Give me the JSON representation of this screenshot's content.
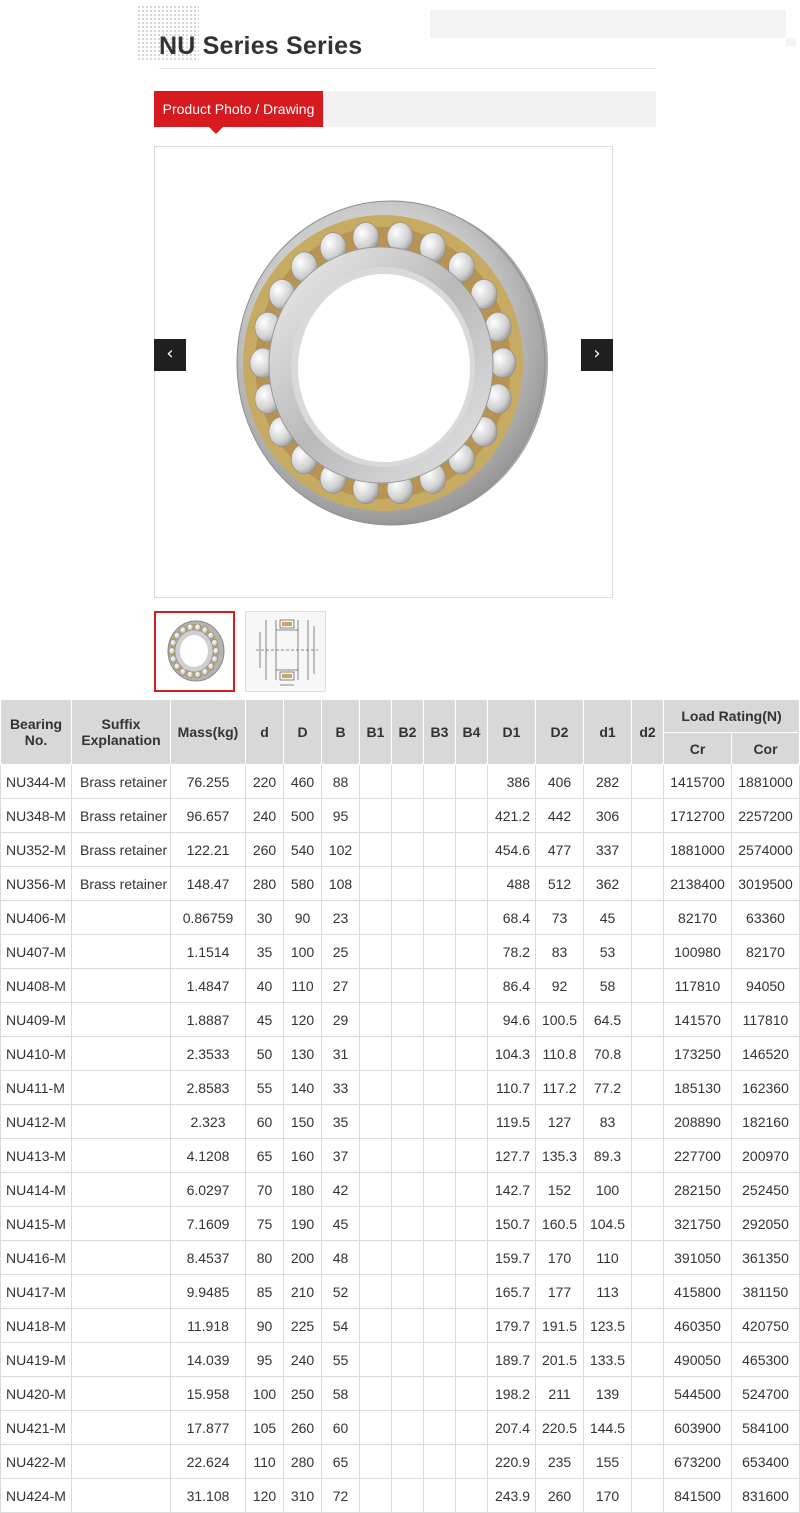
{
  "page": {
    "title": "NU Series Series"
  },
  "tabs": {
    "active_label": "Product Photo / Drawing"
  },
  "gallery": {
    "prev_icon": "‹",
    "next_icon": "›",
    "thumbnails": [
      {
        "name": "bearing-photo-thumb",
        "selected": true
      },
      {
        "name": "bearing-drawing-thumb",
        "selected": false
      }
    ]
  },
  "colors": {
    "accent": "#d71920",
    "header_bg": "#d8d8d8",
    "nav_bg": "#1f1f1f"
  },
  "table": {
    "headers": {
      "bearing_no": "Bearing No.",
      "suffix": "Suffix Explanation",
      "mass": "Mass(kg)",
      "d": "d",
      "D": "D",
      "B": "B",
      "B1": "B1",
      "B2": "B2",
      "B3": "B3",
      "B4": "B4",
      "D1": "D1",
      "D2": "D2",
      "d1": "d1",
      "d2": "d2",
      "load_rating": "Load Rating(N)",
      "cr": "Cr",
      "cor": "Cor"
    },
    "rows": [
      [
        "NU344-M",
        "Brass retainer",
        "76.255",
        "220",
        "460",
        "88",
        "",
        "",
        "",
        "",
        "386",
        "406",
        "282",
        "",
        "1415700",
        "1881000"
      ],
      [
        "NU348-M",
        "Brass retainer",
        "96.657",
        "240",
        "500",
        "95",
        "",
        "",
        "",
        "",
        "421.2",
        "442",
        "306",
        "",
        "1712700",
        "2257200"
      ],
      [
        "NU352-M",
        "Brass retainer",
        "122.21",
        "260",
        "540",
        "102",
        "",
        "",
        "",
        "",
        "454.6",
        "477",
        "337",
        "",
        "1881000",
        "2574000"
      ],
      [
        "NU356-M",
        "Brass retainer",
        "148.47",
        "280",
        "580",
        "108",
        "",
        "",
        "",
        "",
        "488",
        "512",
        "362",
        "",
        "2138400",
        "3019500"
      ],
      [
        "NU406-M",
        "",
        "0.86759",
        "30",
        "90",
        "23",
        "",
        "",
        "",
        "",
        "68.4",
        "73",
        "45",
        "",
        "82170",
        "63360"
      ],
      [
        "NU407-M",
        "",
        "1.1514",
        "35",
        "100",
        "25",
        "",
        "",
        "",
        "",
        "78.2",
        "83",
        "53",
        "",
        "100980",
        "82170"
      ],
      [
        "NU408-M",
        "",
        "1.4847",
        "40",
        "110",
        "27",
        "",
        "",
        "",
        "",
        "86.4",
        "92",
        "58",
        "",
        "117810",
        "94050"
      ],
      [
        "NU409-M",
        "",
        "1.8887",
        "45",
        "120",
        "29",
        "",
        "",
        "",
        "",
        "94.6",
        "100.5",
        "64.5",
        "",
        "141570",
        "117810"
      ],
      [
        "NU410-M",
        "",
        "2.3533",
        "50",
        "130",
        "31",
        "",
        "",
        "",
        "",
        "104.3",
        "110.8",
        "70.8",
        "",
        "173250",
        "146520"
      ],
      [
        "NU411-M",
        "",
        "2.8583",
        "55",
        "140",
        "33",
        "",
        "",
        "",
        "",
        "110.7",
        "117.2",
        "77.2",
        "",
        "185130",
        "162360"
      ],
      [
        "NU412-M",
        "",
        "2.323",
        "60",
        "150",
        "35",
        "",
        "",
        "",
        "",
        "119.5",
        "127",
        "83",
        "",
        "208890",
        "182160"
      ],
      [
        "NU413-M",
        "",
        "4.1208",
        "65",
        "160",
        "37",
        "",
        "",
        "",
        "",
        "127.7",
        "135.3",
        "89.3",
        "",
        "227700",
        "200970"
      ],
      [
        "NU414-M",
        "",
        "6.0297",
        "70",
        "180",
        "42",
        "",
        "",
        "",
        "",
        "142.7",
        "152",
        "100",
        "",
        "282150",
        "252450"
      ],
      [
        "NU415-M",
        "",
        "7.1609",
        "75",
        "190",
        "45",
        "",
        "",
        "",
        "",
        "150.7",
        "160.5",
        "104.5",
        "",
        "321750",
        "292050"
      ],
      [
        "NU416-M",
        "",
        "8.4537",
        "80",
        "200",
        "48",
        "",
        "",
        "",
        "",
        "159.7",
        "170",
        "110",
        "",
        "391050",
        "361350"
      ],
      [
        "NU417-M",
        "",
        "9.9485",
        "85",
        "210",
        "52",
        "",
        "",
        "",
        "",
        "165.7",
        "177",
        "113",
        "",
        "415800",
        "381150"
      ],
      [
        "NU418-M",
        "",
        "11.918",
        "90",
        "225",
        "54",
        "",
        "",
        "",
        "",
        "179.7",
        "191.5",
        "123.5",
        "",
        "460350",
        "420750"
      ],
      [
        "NU419-M",
        "",
        "14.039",
        "95",
        "240",
        "55",
        "",
        "",
        "",
        "",
        "189.7",
        "201.5",
        "133.5",
        "",
        "490050",
        "465300"
      ],
      [
        "NU420-M",
        "",
        "15.958",
        "100",
        "250",
        "58",
        "",
        "",
        "",
        "",
        "198.2",
        "211",
        "139",
        "",
        "544500",
        "524700"
      ],
      [
        "NU421-M",
        "",
        "17.877",
        "105",
        "260",
        "60",
        "",
        "",
        "",
        "",
        "207.4",
        "220.5",
        "144.5",
        "",
        "603900",
        "584100"
      ],
      [
        "NU422-M",
        "",
        "22.624",
        "110",
        "280",
        "65",
        "",
        "",
        "",
        "",
        "220.9",
        "235",
        "155",
        "",
        "673200",
        "653400"
      ],
      [
        "NU424-M",
        "",
        "31.108",
        "120",
        "310",
        "72",
        "",
        "",
        "",
        "",
        "243.9",
        "260",
        "170",
        "",
        "841500",
        "831600"
      ]
    ]
  }
}
